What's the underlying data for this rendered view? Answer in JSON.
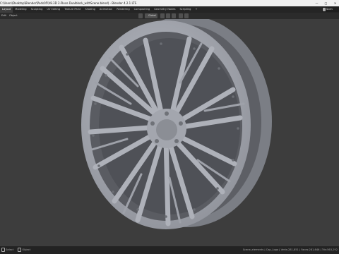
{
  "titlebar": {
    "title": "C:\\Users\\Desktop\\Blender\\Pods05\\V8.3D 2-Piece Dualblock_withScene.blend) - Blender 4.2.1 LTS",
    "minimize": "—",
    "maximize": "□",
    "close": "✕"
  },
  "workspace": {
    "tabs": [
      "Layout",
      "Modeling",
      "Sculpting",
      "UV Editing",
      "Texture Paint",
      "Shading",
      "Animation",
      "Rendering",
      "Compositing",
      "Geometry Nodes",
      "Scripting",
      "+"
    ],
    "active_tab": "Layout",
    "scene_label": "Scen"
  },
  "header": {
    "menus": [
      "Edit",
      "Object"
    ],
    "transform_orientation": "Global"
  },
  "statusbar": {
    "left_items": [
      "Select",
      "Object"
    ],
    "right_text": "Scene_elements | Cap_Logo | Verts:281,851 | Faces:281,646 | Tris:563,292"
  },
  "colors": {
    "viewport_bg": "#3d3d3d",
    "wheel_base": "#a6a9b1",
    "active_tab": "#3d3d3d"
  }
}
